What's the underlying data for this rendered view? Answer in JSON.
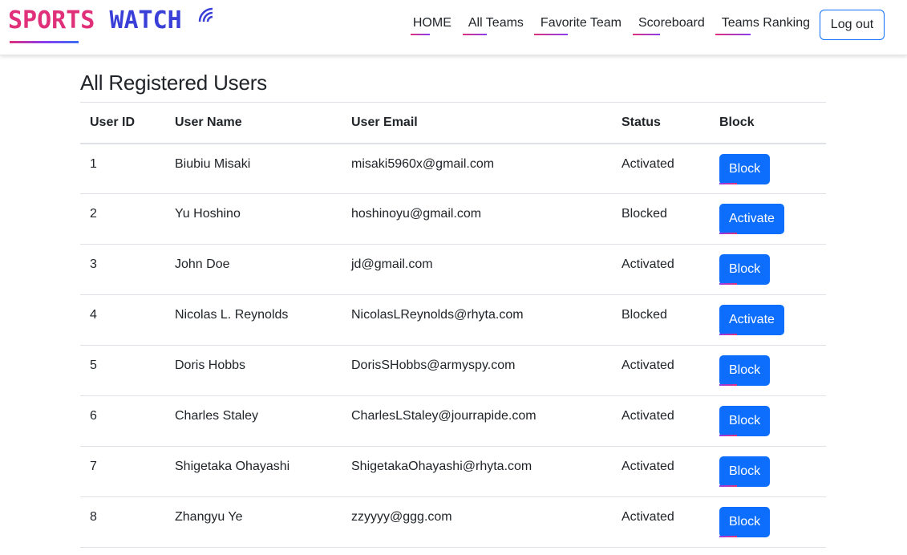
{
  "brand": {
    "word1": "SPORTS",
    "word2": "WATCH",
    "colors": {
      "pink": "#e0307a",
      "blue": "#3a3fd8"
    }
  },
  "nav": {
    "items": [
      {
        "label": "HOME"
      },
      {
        "label": "All Teams"
      },
      {
        "label": "Favorite Team"
      },
      {
        "label": "Scoreboard"
      },
      {
        "label": "Teams Ranking"
      }
    ],
    "logout_label": "Log out"
  },
  "page": {
    "title": "All Registered Users"
  },
  "table": {
    "headers": [
      "User ID",
      "User Name",
      "User Email",
      "Status",
      "Block"
    ],
    "rows": [
      {
        "id": "1",
        "name": "Biubiu Misaki",
        "email": "misaki5960x@gmail.com",
        "status": "Activated",
        "action": "Block"
      },
      {
        "id": "2",
        "name": "Yu Hoshino",
        "email": "hoshinoyu@gmail.com",
        "status": "Blocked",
        "action": "Activate"
      },
      {
        "id": "3",
        "name": "John Doe",
        "email": "jd@gmail.com",
        "status": "Activated",
        "action": "Block"
      },
      {
        "id": "4",
        "name": "Nicolas L. Reynolds",
        "email": "NicolasLReynolds@rhyta.com",
        "status": "Blocked",
        "action": "Activate"
      },
      {
        "id": "5",
        "name": "Doris Hobbs",
        "email": "DorisSHobbs@armyspy.com",
        "status": "Activated",
        "action": "Block"
      },
      {
        "id": "6",
        "name": "Charles Staley",
        "email": "CharlesLStaley@jourrapide.com",
        "status": "Activated",
        "action": "Block"
      },
      {
        "id": "7",
        "name": "Shigetaka Ohayashi",
        "email": "ShigetakaOhayashi@rhyta.com",
        "status": "Activated",
        "action": "Block"
      },
      {
        "id": "8",
        "name": "Zhangyu Ye",
        "email": "zzyyyy@ggg.com",
        "status": "Activated",
        "action": "Block"
      }
    ]
  },
  "theme": {
    "primary": "#0d6efd",
    "text": "#212529",
    "border": "#dee2e6"
  }
}
